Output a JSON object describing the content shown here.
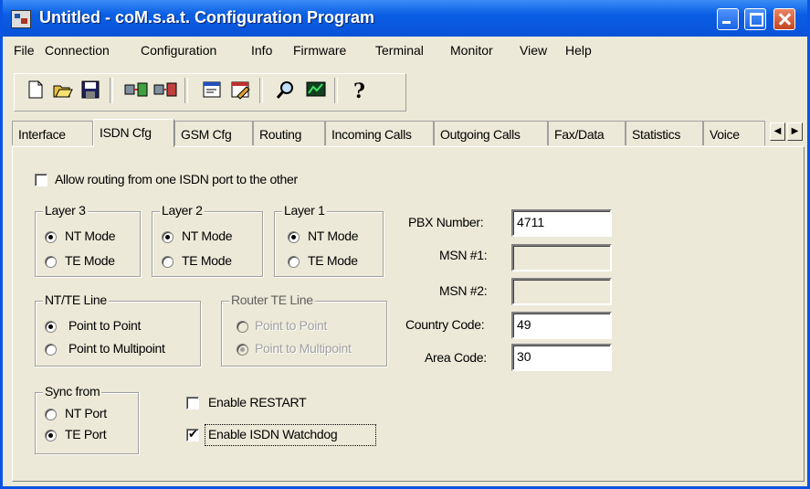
{
  "window": {
    "title": "Untitled - coM.s.a.t. Configuration Program"
  },
  "menu": [
    {
      "label": "File"
    },
    {
      "label": "Connection"
    },
    {
      "label": "Configuration"
    },
    {
      "label": "Info"
    },
    {
      "label": "Firmware"
    },
    {
      "label": "Terminal"
    },
    {
      "label": "Monitor"
    },
    {
      "label": "View"
    },
    {
      "label": "Help"
    }
  ],
  "toolbar": {
    "icons": [
      "new-icon",
      "open-icon",
      "save-icon",
      "connect-icon",
      "disconnect-icon",
      "read-config-icon",
      "write-config-icon",
      "search-icon",
      "monitor-icon",
      "help-icon"
    ]
  },
  "tabs": [
    {
      "label": "Interface"
    },
    {
      "label": "ISDN Cfg"
    },
    {
      "label": "GSM Cfg"
    },
    {
      "label": "Routing"
    },
    {
      "label": "Incoming Calls"
    },
    {
      "label": "Outgoing Calls"
    },
    {
      "label": "Fax/Data"
    },
    {
      "label": "Statistics"
    },
    {
      "label": "Voice"
    }
  ],
  "active_tab": "ISDN Cfg",
  "isdn": {
    "allow_routing": {
      "label": "Allow routing from one ISDN port to the other",
      "checked": false
    },
    "layer3": {
      "title": "Layer 3",
      "options": [
        "NT Mode",
        "TE Mode"
      ],
      "selected": "NT Mode"
    },
    "layer2": {
      "title": "Layer 2",
      "options": [
        "NT Mode",
        "TE Mode"
      ],
      "selected": "NT Mode"
    },
    "layer1": {
      "title": "Layer 1",
      "options": [
        "NT Mode",
        "TE Mode"
      ],
      "selected": "NT Mode"
    },
    "ntte_line": {
      "title": "NT/TE Line",
      "options": [
        "Point to Point",
        "Point to Multipoint"
      ],
      "selected": "Point to Point"
    },
    "router_te_line": {
      "title": "Router TE Line",
      "options": [
        "Point to Point",
        "Point to Multipoint"
      ],
      "selected": "Point to Multipoint",
      "enabled": false
    },
    "sync_from": {
      "title": "Sync from",
      "options": [
        "NT Port",
        "TE Port"
      ],
      "selected": "TE Port"
    },
    "enable_restart": {
      "label": "Enable RESTART",
      "checked": false
    },
    "enable_watchdog": {
      "label": "Enable ISDN Watchdog",
      "checked": true
    },
    "fields": {
      "pbx_number": {
        "label": "PBX Number:",
        "value": "4711"
      },
      "msn1": {
        "label": "MSN #1:",
        "value": ""
      },
      "msn2": {
        "label": "MSN #2:",
        "value": ""
      },
      "country_code": {
        "label": "Country Code:",
        "value": "49"
      },
      "area_code": {
        "label": "Area Code:",
        "value": "30"
      }
    }
  }
}
